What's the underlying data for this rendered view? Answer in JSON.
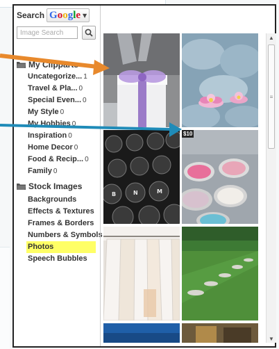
{
  "search": {
    "label": "Search",
    "provider": [
      "G",
      "o",
      "o",
      "g",
      "l",
      "e"
    ],
    "placeholder": "Image Search"
  },
  "sidebar": {
    "my_group": {
      "title": "My Clipparts",
      "items": [
        {
          "label": "Uncategorize...",
          "count": "1"
        },
        {
          "label": "Travel & Pla...",
          "count": "0"
        },
        {
          "label": "Special Even...",
          "count": "0"
        },
        {
          "label": "My Style",
          "count": "0"
        },
        {
          "label": "My Hobbies",
          "count": "0"
        },
        {
          "label": "Inspiration",
          "count": "0"
        },
        {
          "label": "Home Decor",
          "count": "0"
        },
        {
          "label": "Food & Recip...",
          "count": "0"
        },
        {
          "label": "Family",
          "count": "0"
        }
      ]
    },
    "stock_group": {
      "title": "Stock Images",
      "items": [
        {
          "label": "Backgrounds"
        },
        {
          "label": "Effects & Textures"
        },
        {
          "label": "Frames & Borders"
        },
        {
          "label": "Numbers & Symbols"
        },
        {
          "label": "Photos",
          "active": true
        },
        {
          "label": "Speech Bubbles"
        }
      ]
    }
  },
  "gallery": {
    "price_badge": "$10",
    "thumbnails": [
      {
        "subject": "gift box with purple ribbon"
      },
      {
        "subject": "pink water lilies"
      },
      {
        "subject": "typewriter keys"
      },
      {
        "subject": "makeup palette"
      },
      {
        "subject": "white clothes on hangers"
      },
      {
        "subject": "green lawn with stepping stones"
      }
    ]
  },
  "colors": {
    "arrow": "#e8892c",
    "arrow2": "#1f8bb8",
    "active_highlight": "#ffff66"
  }
}
